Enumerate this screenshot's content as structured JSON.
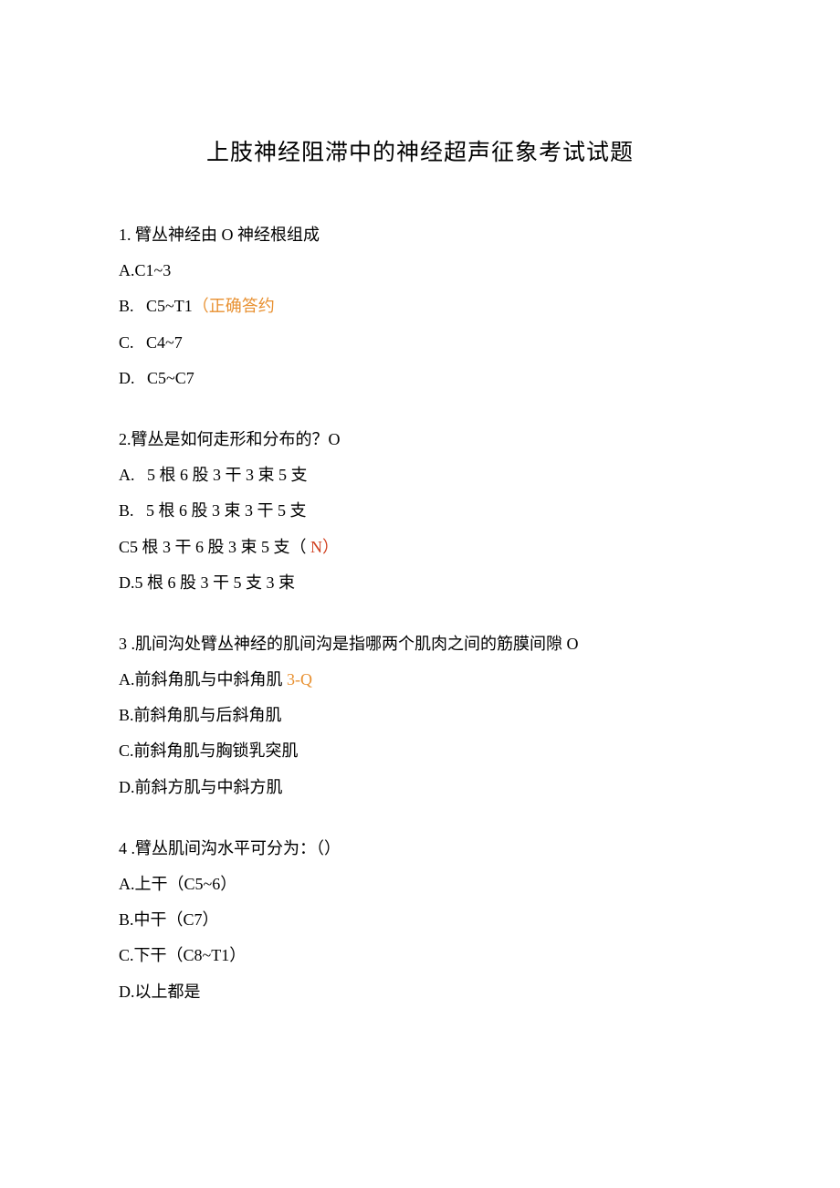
{
  "title": "上肢神经阻滞中的神经超声征象考试试题",
  "questions": [
    {
      "text": "1. 臂丛神经由 O 神经根组成",
      "options": [
        {
          "pre": "A.",
          "main": "C1~3",
          "hl": ""
        },
        {
          "pre": "B.   ",
          "main": "C5~T1",
          "hl": "（正确答约",
          "hlClass": "hl-orange"
        },
        {
          "pre": "C.   ",
          "main": "C4~7",
          "hl": ""
        },
        {
          "pre": "D.   ",
          "main": "C5~C7",
          "hl": ""
        }
      ]
    },
    {
      "text": "2.臂丛是如何走形和分布的？O",
      "options": [
        {
          "pre": "A.   ",
          "main": "5 根 6 股 3 干 3 束 5 支",
          "hl": ""
        },
        {
          "pre": "B.   ",
          "main": "5 根 6 股 3 束 3 干 5 支",
          "hl": ""
        },
        {
          "pre": "",
          "main": "C5 根 3 干 6 股 3 束 5 支（     ",
          "hl": "N）",
          "hlClass": "hl-red"
        },
        {
          "pre": "D.",
          "main": "5 根 6 股 3 干 5 支 3 束",
          "hl": ""
        }
      ]
    },
    {
      "text": "3   .肌间沟处臂丛神经的肌间沟是指哪两个肌肉之间的筋膜间隙 O",
      "options": [
        {
          "pre": "A.",
          "main": "前斜角肌与中斜角肌 ",
          "hl": "3-Q",
          "hlClass": "hl-orange"
        },
        {
          "pre": "B.",
          "main": "前斜角肌与后斜角肌",
          "hl": ""
        },
        {
          "pre": "C.",
          "main": "前斜角肌与胸锁乳突肌",
          "hl": ""
        },
        {
          "pre": "D.",
          "main": "前斜方肌与中斜方肌",
          "hl": ""
        }
      ]
    },
    {
      "text": "4   .臂丛肌间沟水平可分为：（）",
      "options": [
        {
          "pre": "A.",
          "main": "上干（C5~6）",
          "hl": ""
        },
        {
          "pre": "B.",
          "main": "中干（C7）",
          "hl": ""
        },
        {
          "pre": "C.",
          "main": "下干（C8~T1）",
          "hl": ""
        },
        {
          "pre": "D.",
          "main": "以上都是",
          "hl": ""
        }
      ]
    }
  ]
}
